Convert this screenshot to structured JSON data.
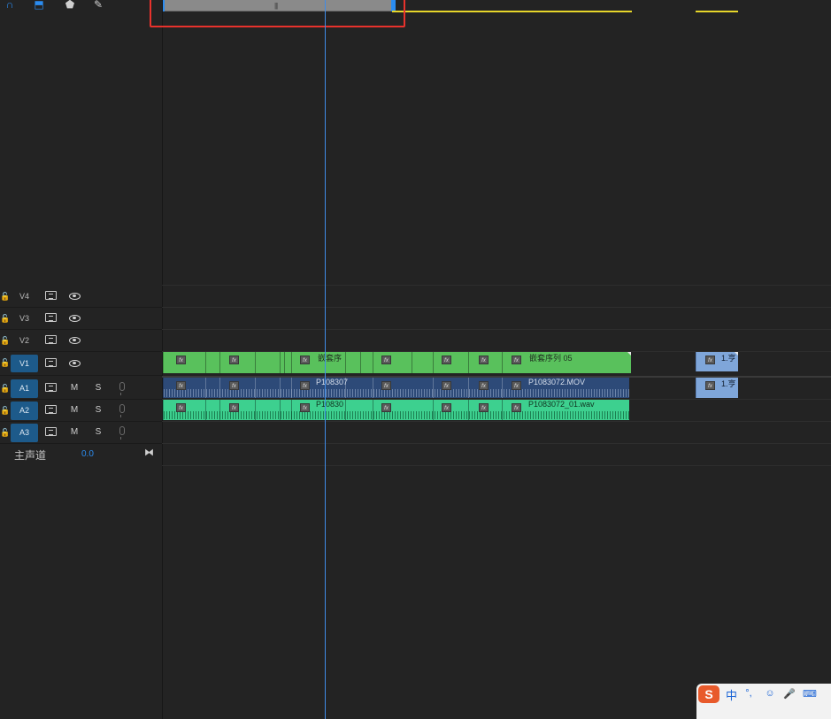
{
  "toolbar": {
    "tools": [
      {
        "name": "magnet-icon",
        "glyph": "∩"
      },
      {
        "name": "linked-selection-icon",
        "glyph": "⬒"
      },
      {
        "name": "marker-icon",
        "glyph": "⬟"
      },
      {
        "name": "wrench-icon",
        "glyph": "🔧"
      }
    ]
  },
  "tracks": {
    "video": [
      {
        "label": "V4"
      },
      {
        "label": "V3"
      },
      {
        "label": "V2"
      },
      {
        "label": "V1"
      }
    ],
    "audio": [
      {
        "label": "A1",
        "m": "M",
        "s": "S"
      },
      {
        "label": "A2",
        "m": "M",
        "s": "S"
      },
      {
        "label": "A3",
        "m": "M",
        "s": "S"
      }
    ],
    "master": {
      "label": "主声道",
      "value": "0.0"
    }
  },
  "clips": {
    "v1_name_a": "嵌套序",
    "v1_name_b": "嵌套序列 05",
    "a1_name_a": "P108307",
    "a1_name_b": "P1083072.MOV",
    "a2_name_a": "P10830",
    "a2_name_b": "P1083072_01.wav",
    "far_v1": "1.亨",
    "far_a1": "1.亨",
    "fx": "fx"
  },
  "ime": {
    "logo": "S",
    "lang": "中"
  },
  "colors": {
    "video_clip": "#59c15c",
    "audio_clip_a1": "#2d4a78",
    "audio_clip_a2": "#3dd08f",
    "playhead": "#3f8ce8",
    "highlight_box": "#e8322c",
    "render_bar": "#e6d62a"
  }
}
